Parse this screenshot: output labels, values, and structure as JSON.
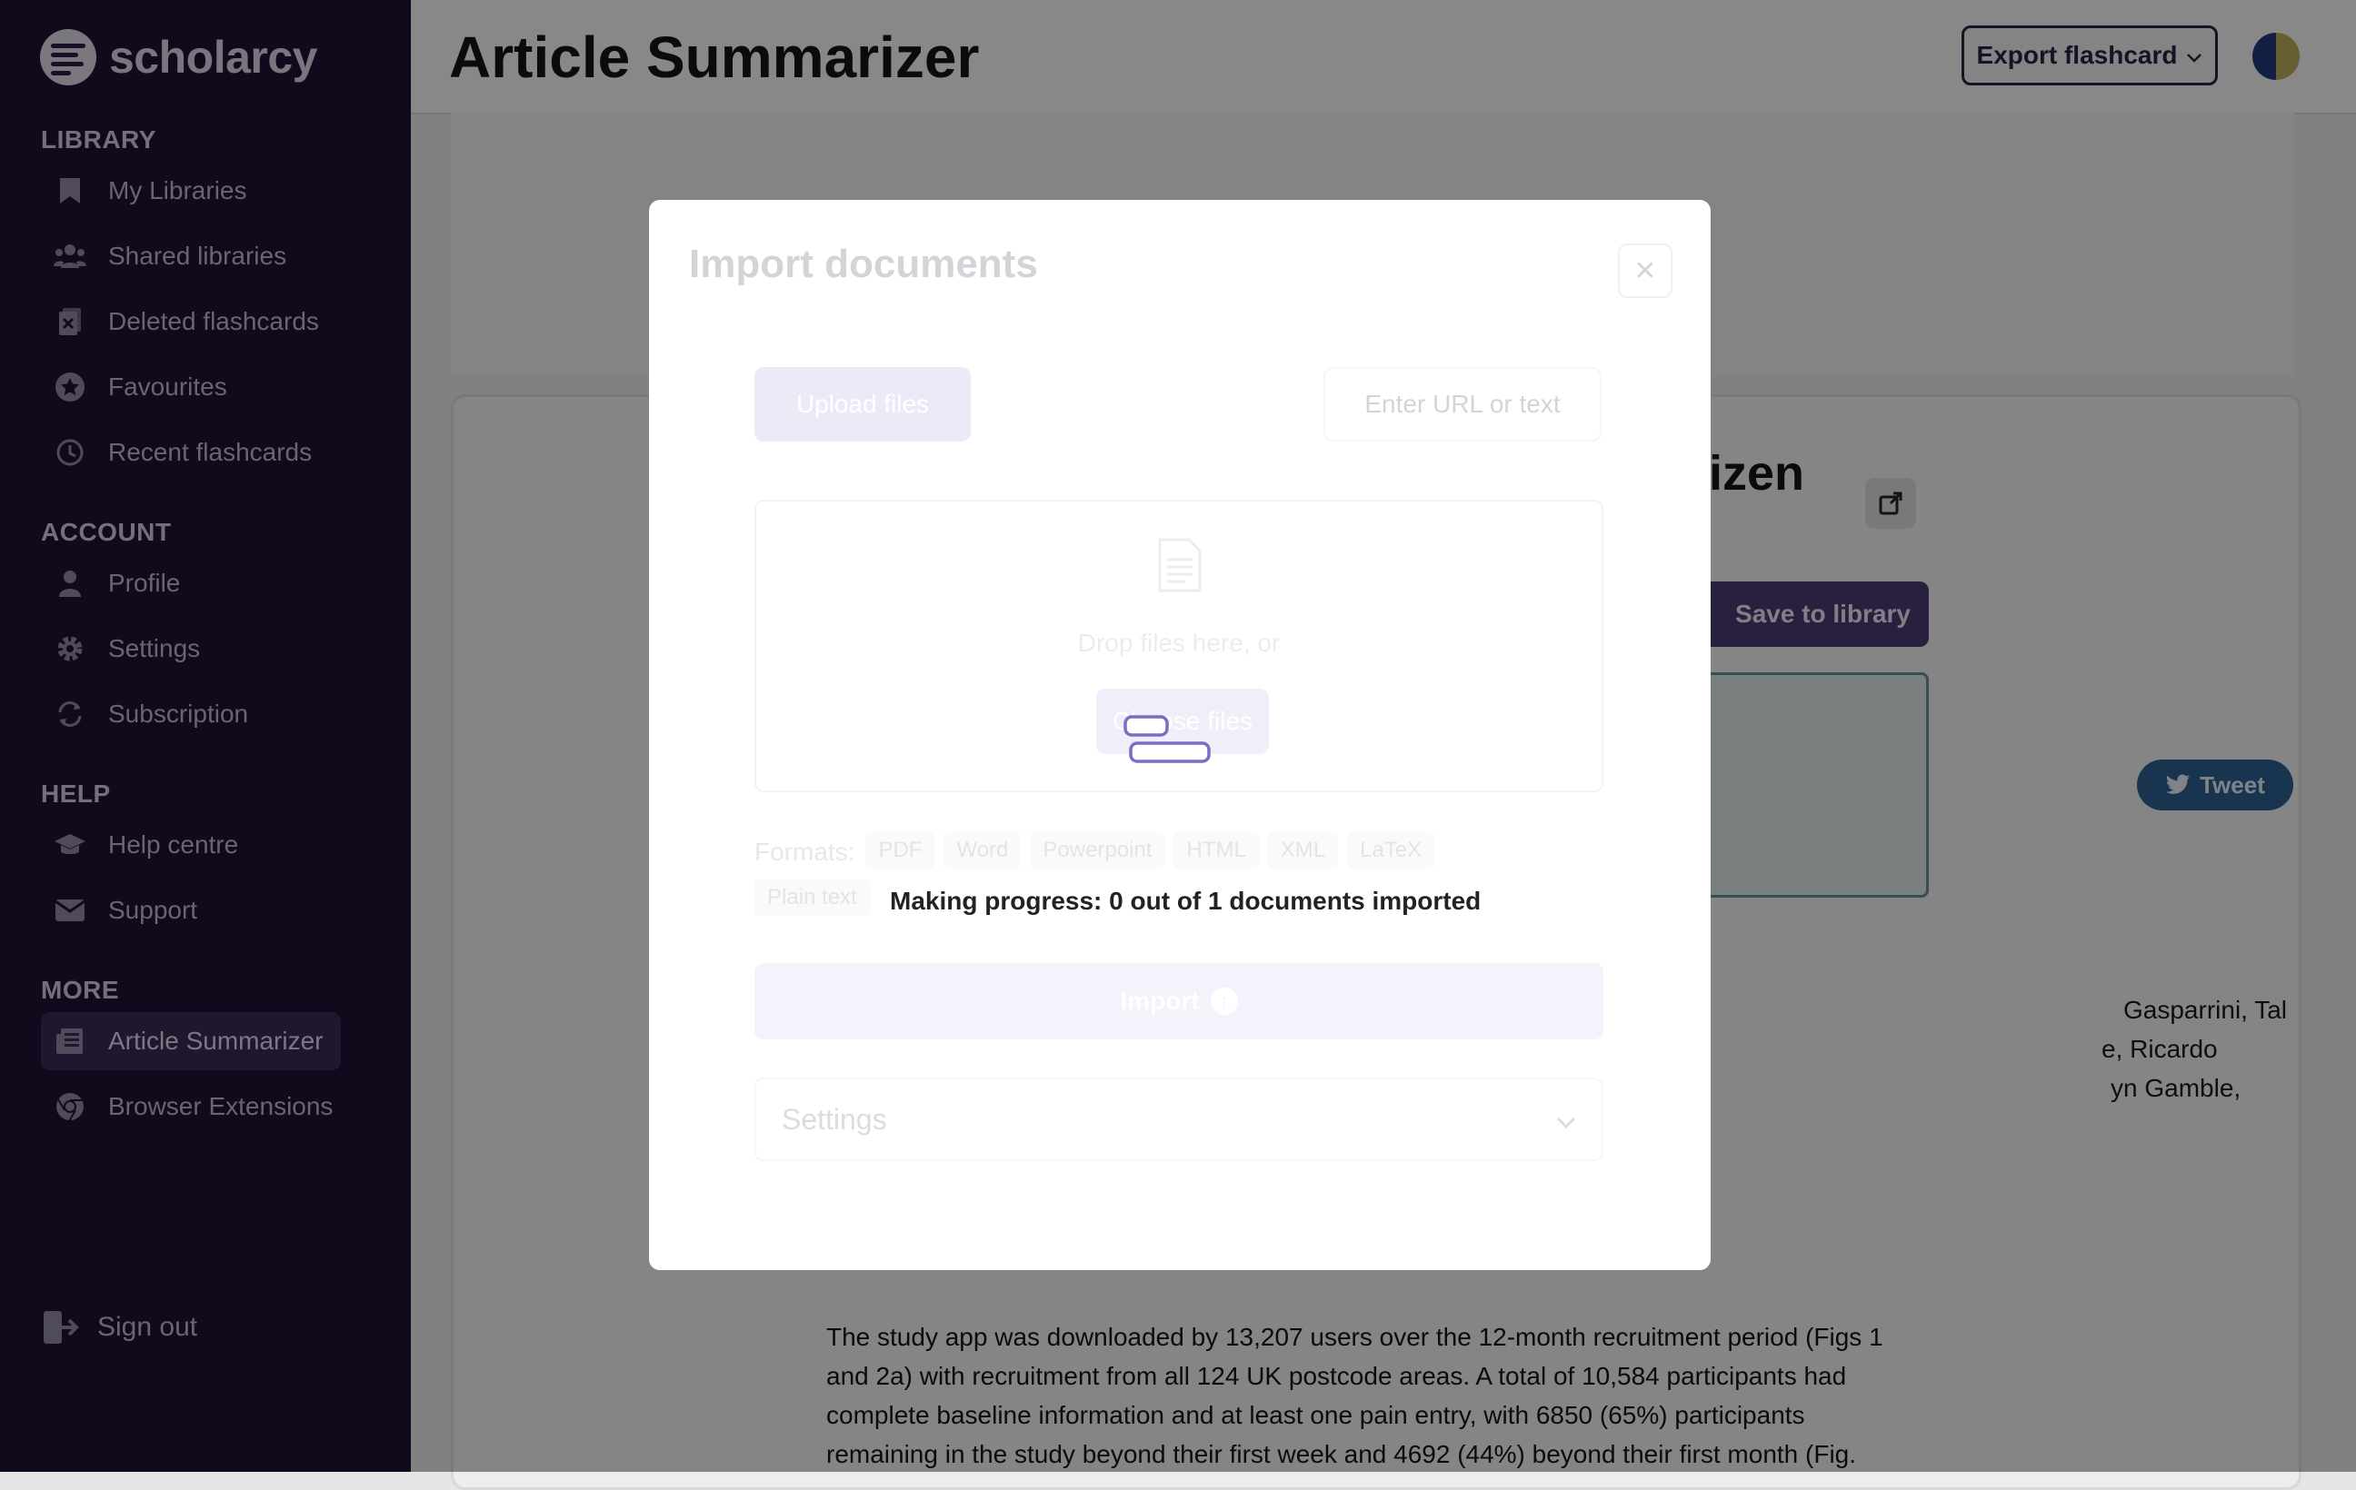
{
  "sidebar": {
    "brand": "scholarcy",
    "sections": [
      {
        "title": "LIBRARY",
        "items": [
          {
            "label": "My Libraries",
            "icon": "bookmark-icon"
          },
          {
            "label": "Shared libraries",
            "icon": "users-icon"
          },
          {
            "label": "Deleted flashcards",
            "icon": "deleted-doc-icon"
          },
          {
            "label": "Favourites",
            "icon": "star-icon"
          },
          {
            "label": "Recent flashcards",
            "icon": "clock-icon"
          }
        ]
      },
      {
        "title": "ACCOUNT",
        "items": [
          {
            "label": "Profile",
            "icon": "user-icon"
          },
          {
            "label": "Settings",
            "icon": "gear-icon"
          },
          {
            "label": "Subscription",
            "icon": "refresh-icon"
          }
        ]
      },
      {
        "title": "HELP",
        "items": [
          {
            "label": "Help centre",
            "icon": "graduation-cap-icon"
          },
          {
            "label": "Support",
            "icon": "envelope-icon"
          }
        ]
      },
      {
        "title": "MORE",
        "items": [
          {
            "label": "Article Summarizer",
            "icon": "newspaper-icon",
            "active": true
          },
          {
            "label": "Browser Extensions",
            "icon": "chrome-icon"
          }
        ]
      }
    ],
    "signout": "Sign out"
  },
  "header": {
    "title": "Article Summarizer",
    "export_label": "Export flashcard"
  },
  "background": {
    "heading_fragment": "izen",
    "save_label": "Save to library",
    "tweet_label": "Tweet",
    "authors_lines": [
      "Gasparrini, Tal",
      "e, Ricardo",
      "yn Gamble,"
    ],
    "body_lines": [
      "The study app was downloaded by 13,207 users over the 12-month recruitment period (Figs 1",
      "and 2a) with recruitment from all 124 UK postcode areas. A total of 10,584 participants had",
      "complete baseline information and at least one pain entry, with 6850 (65%) participants",
      "remaining in the study beyond their first week and 4692 (44%) beyond their first month (Fig."
    ]
  },
  "modal": {
    "title": "Import documents",
    "close_icon": "close-icon",
    "upload_tab": "Upload files",
    "url_placeholder": "Enter URL or text",
    "drop_text": "Drop files here, or",
    "choose_label": "Choose files",
    "formats_label": "Formats:",
    "formats": [
      "PDF",
      "Word",
      "Powerpoint",
      "HTML",
      "XML",
      "LaTeX",
      "Plain text"
    ],
    "progress": "Making progress: 0 out of 1 documents imported",
    "import_label": "Import",
    "settings_label": "Settings"
  },
  "colors": {
    "sidebar_bg": "#1f1233",
    "accent": "#4a3a70",
    "spinner": "#7b6cc4",
    "tweet": "#2c5e8e"
  }
}
